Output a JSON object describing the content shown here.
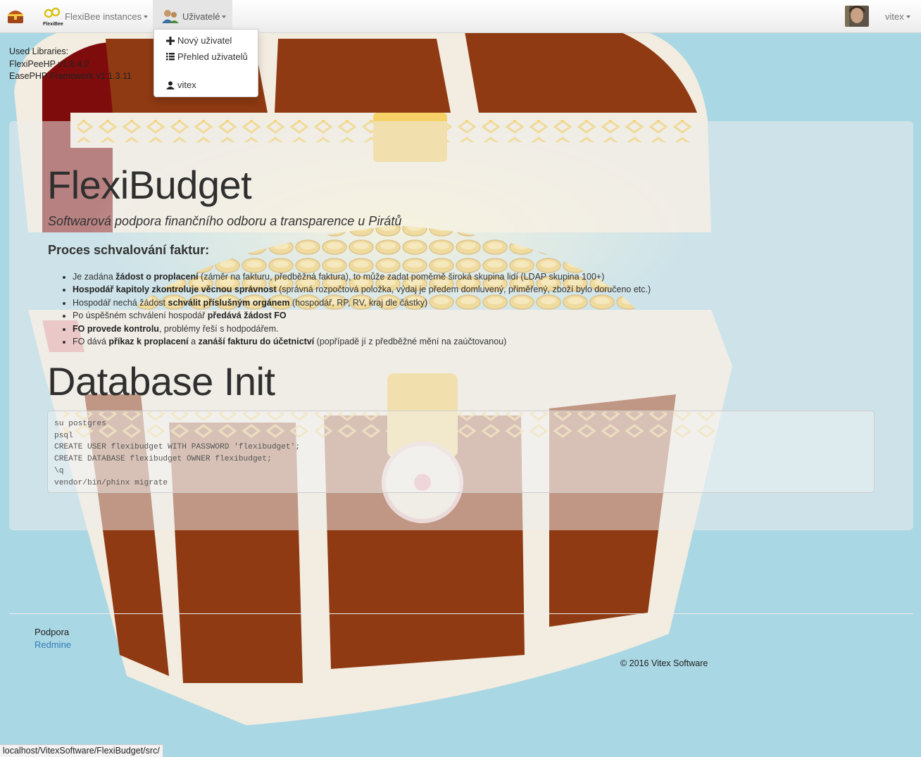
{
  "navbar": {
    "brand_icon": "treasure-chest-icon",
    "flexibee_logo_text": "FlexiBee",
    "flexibee_menu": "FlexiBee instances",
    "users_menu": "Uživatelé",
    "current_user": "vitex"
  },
  "users_dropdown": {
    "items": [
      {
        "label": "Nový uživatel",
        "icon": "plus-icon"
      },
      {
        "label": "Přehled uživatelů",
        "icon": "list-icon"
      },
      {
        "label": "vitex",
        "icon": "user-icon"
      }
    ]
  },
  "libraries": {
    "heading": "Used Libraries:",
    "items": [
      "FlexiPeeHP v1.6.4.2",
      "EasePHP Framework v1.1.3.11"
    ]
  },
  "main": {
    "title": "FlexiBudget",
    "lead": "Softwarová podpora finančního odboru a transparence u Pirátů",
    "process_heading": "Proces schvalování faktur:",
    "process_steps": [
      [
        {
          "t": "Je zadána "
        },
        {
          "t": "žádost o proplacení",
          "b": true
        },
        {
          "t": " (záměr na fakturu, předběžná faktura), to může zadat poměrně široká skupina lidí (LDAP skupina 100+)"
        }
      ],
      [
        {
          "t": "Hospodář kapitoly zkontroluje věcnou správnost",
          "b": true
        },
        {
          "t": " (správná rozpočtová položka, výdaj je předem domluvený, přiměřený, zboží bylo doručeno etc.)"
        }
      ],
      [
        {
          "t": "Hospodář nechá žádost "
        },
        {
          "t": "schválit příslušným orgánem",
          "b": true
        },
        {
          "t": " (hospodář, RP, RV, kraj dle částky)"
        }
      ],
      [
        {
          "t": "Po úspěšném schválení hospodář "
        },
        {
          "t": "předává žádost FO",
          "b": true
        }
      ],
      [
        {
          "t": "FO provede kontrolu",
          "b": true
        },
        {
          "t": ", problémy řeší s hodpodářem."
        }
      ],
      [
        {
          "t": "FO dává "
        },
        {
          "t": "příkaz k proplacení",
          "b": true
        },
        {
          "t": " a "
        },
        {
          "t": "zanáší fakturu do účetnictví",
          "b": true
        },
        {
          "t": " (popřípadě jí z předběžné mění na zaúčtovanou)"
        }
      ]
    ],
    "db_title": "Database Init",
    "code": "su postgres\npsql\nCREATE USER flexibudget WITH PASSWORD 'flexibudget';\nCREATE DATABASE flexibudget OWNER flexibudget;\n\\q\nvendor/bin/phinx migrate"
  },
  "footer": {
    "heading": "Podpora",
    "link": "Redmine",
    "copyright": "© 2016 Vitex Software"
  },
  "statusbar": {
    "url": "localhost/VitexSoftware/FlexiBudget/src/"
  },
  "colors": {
    "background": "#a9d7e4",
    "chest_wood": "#8f3a12",
    "chest_trim": "#f3ece0",
    "gold": "#f5c842",
    "link": "#337ab7"
  }
}
